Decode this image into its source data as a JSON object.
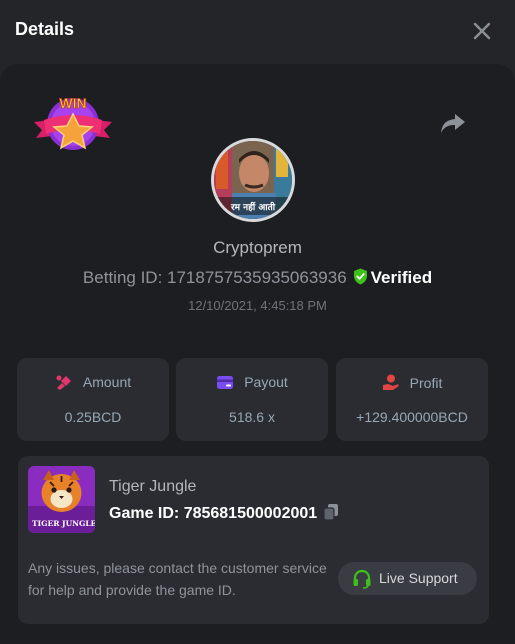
{
  "header": {
    "title": "Details"
  },
  "user": {
    "name": "Cryptoprem",
    "betting_id_label": "Betting ID: 1718757535935063936",
    "verified_label": "Verified",
    "timestamp": "12/10/2021, 4:45:18 PM",
    "avatar_caption": "रम नहीं आती",
    "badge_text": "WIN"
  },
  "stats": [
    {
      "label": "Amount",
      "value": "0.25BCD",
      "icon": "coins-icon",
      "color": "#e0386a"
    },
    {
      "label": "Payout",
      "value": "518.6 x",
      "icon": "payout-card-icon",
      "color": "#7b4cf0"
    },
    {
      "label": "Profit",
      "value": "+129.400000BCD",
      "icon": "profit-hand-icon",
      "color": "#e34444"
    }
  ],
  "game": {
    "name": "Tiger Jungle",
    "id_label": "Game ID: 785681500002001",
    "thumb_caption": "TIGER JUNGLE",
    "help_text": "Any issues, please contact the customer service for help and provide the game ID.",
    "support_label": "Live Support"
  },
  "colors": {
    "accent_green": "#3bc117",
    "background": "#1d1e22",
    "card": "#2a2c31"
  }
}
